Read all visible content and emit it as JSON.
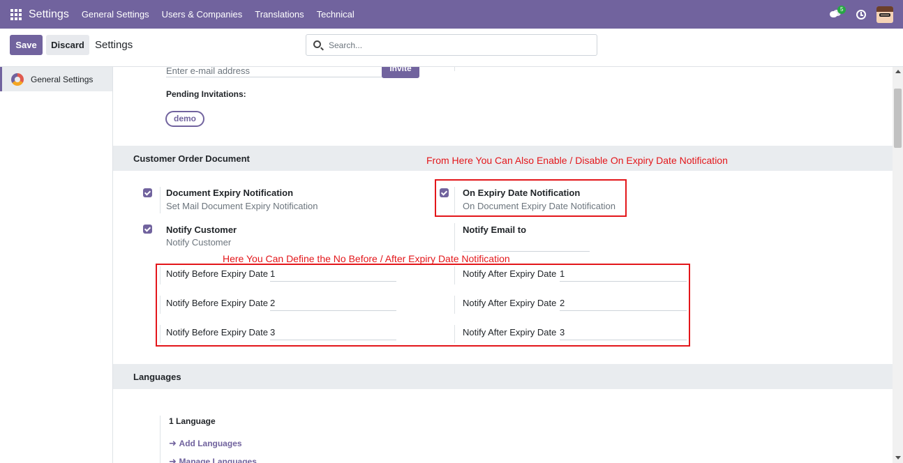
{
  "navbar": {
    "app_name": "Settings",
    "menus": [
      "General Settings",
      "Users & Companies",
      "Translations",
      "Technical"
    ],
    "chat_count": "5"
  },
  "control": {
    "save_label": "Save",
    "discard_label": "Discard",
    "breadcrumb": "Settings",
    "search_placeholder": "Search..."
  },
  "sidebar": {
    "items": [
      {
        "label": "General Settings"
      }
    ]
  },
  "users": {
    "invite_placeholder": "Enter e-mail address",
    "invite_label": "Invite",
    "pending_label": "Pending Invitations:",
    "pending": [
      "demo"
    ]
  },
  "customer_order": {
    "title": "Customer Order Document",
    "annotation_top": "From Here You Can Also Enable / Disable On Expiry Date Notification",
    "annotation_mid": "Here You Can Define the No Before / After Expiry Date Notification",
    "doc_expiry": {
      "title": "Document Expiry Notification",
      "desc": "Set Mail Document Expiry Notification",
      "checked": true
    },
    "on_expiry": {
      "title": "On Expiry Date Notification",
      "desc": "On Document Expiry Date Notification",
      "checked": true
    },
    "notify_customer": {
      "title": "Notify Customer",
      "desc": "Notify Customer",
      "checked": true
    },
    "notify_email": {
      "title": "Notify Email to",
      "value": ""
    },
    "before": [
      {
        "label": "Notify Before Expiry Date",
        "value": "1"
      },
      {
        "label": "Notify Before Expiry Date",
        "value": "2"
      },
      {
        "label": "Notify Before Expiry Date",
        "value": "3"
      }
    ],
    "after": [
      {
        "label": "Notify After Expiry Date",
        "value": "1"
      },
      {
        "label": "Notify After Expiry Date",
        "value": "2"
      },
      {
        "label": "Notify After Expiry Date",
        "value": "3"
      }
    ]
  },
  "languages": {
    "title": "Languages",
    "count_label": "1 Language",
    "add_label": "Add Languages",
    "manage_label": "Manage Languages"
  },
  "colors": {
    "brand": "#71639e",
    "annotation": "#e3161a"
  }
}
